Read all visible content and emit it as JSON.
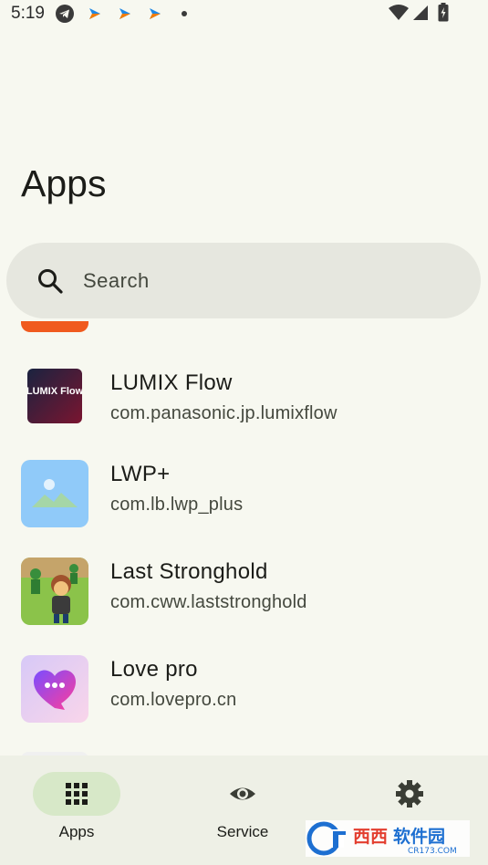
{
  "status_bar": {
    "time": "5:19",
    "icons": [
      "telegram-icon",
      "notification-icon",
      "notification-icon",
      "notification-icon",
      "dot-icon",
      "wifi-icon",
      "signal-icon",
      "battery-icon"
    ]
  },
  "page": {
    "title": "Apps"
  },
  "search": {
    "placeholder": "Search",
    "value": ""
  },
  "apps": [
    {
      "name": "LUMIX Flow",
      "package": "com.panasonic.jp.lumixflow",
      "icon": "lumix-flow-icon",
      "icon_text": "LUMIX Flow"
    },
    {
      "name": "LWP+",
      "package": "com.lb.lwp_plus",
      "icon": "image-placeholder-icon"
    },
    {
      "name": "Last Stronghold",
      "package": "com.cww.laststronghold",
      "icon": "last-stronghold-icon"
    },
    {
      "name": "Love pro",
      "package": "com.lovepro.cn",
      "icon": "love-pro-icon"
    }
  ],
  "bottom_nav": {
    "items": [
      {
        "label": "Apps",
        "icon": "grid-icon",
        "active": true
      },
      {
        "label": "Service",
        "icon": "eye-icon",
        "active": false
      },
      {
        "label": "",
        "icon": "gear-icon",
        "active": false
      }
    ]
  },
  "watermark": {
    "text": "西西软件园",
    "subtext": "CR173.COM",
    "brand_color": "#1d6fd1"
  },
  "colors": {
    "background": "#f7f8f0",
    "search_bg": "#e6e7df",
    "nav_bg": "#eef0e6",
    "nav_active": "#d7e8c8"
  }
}
